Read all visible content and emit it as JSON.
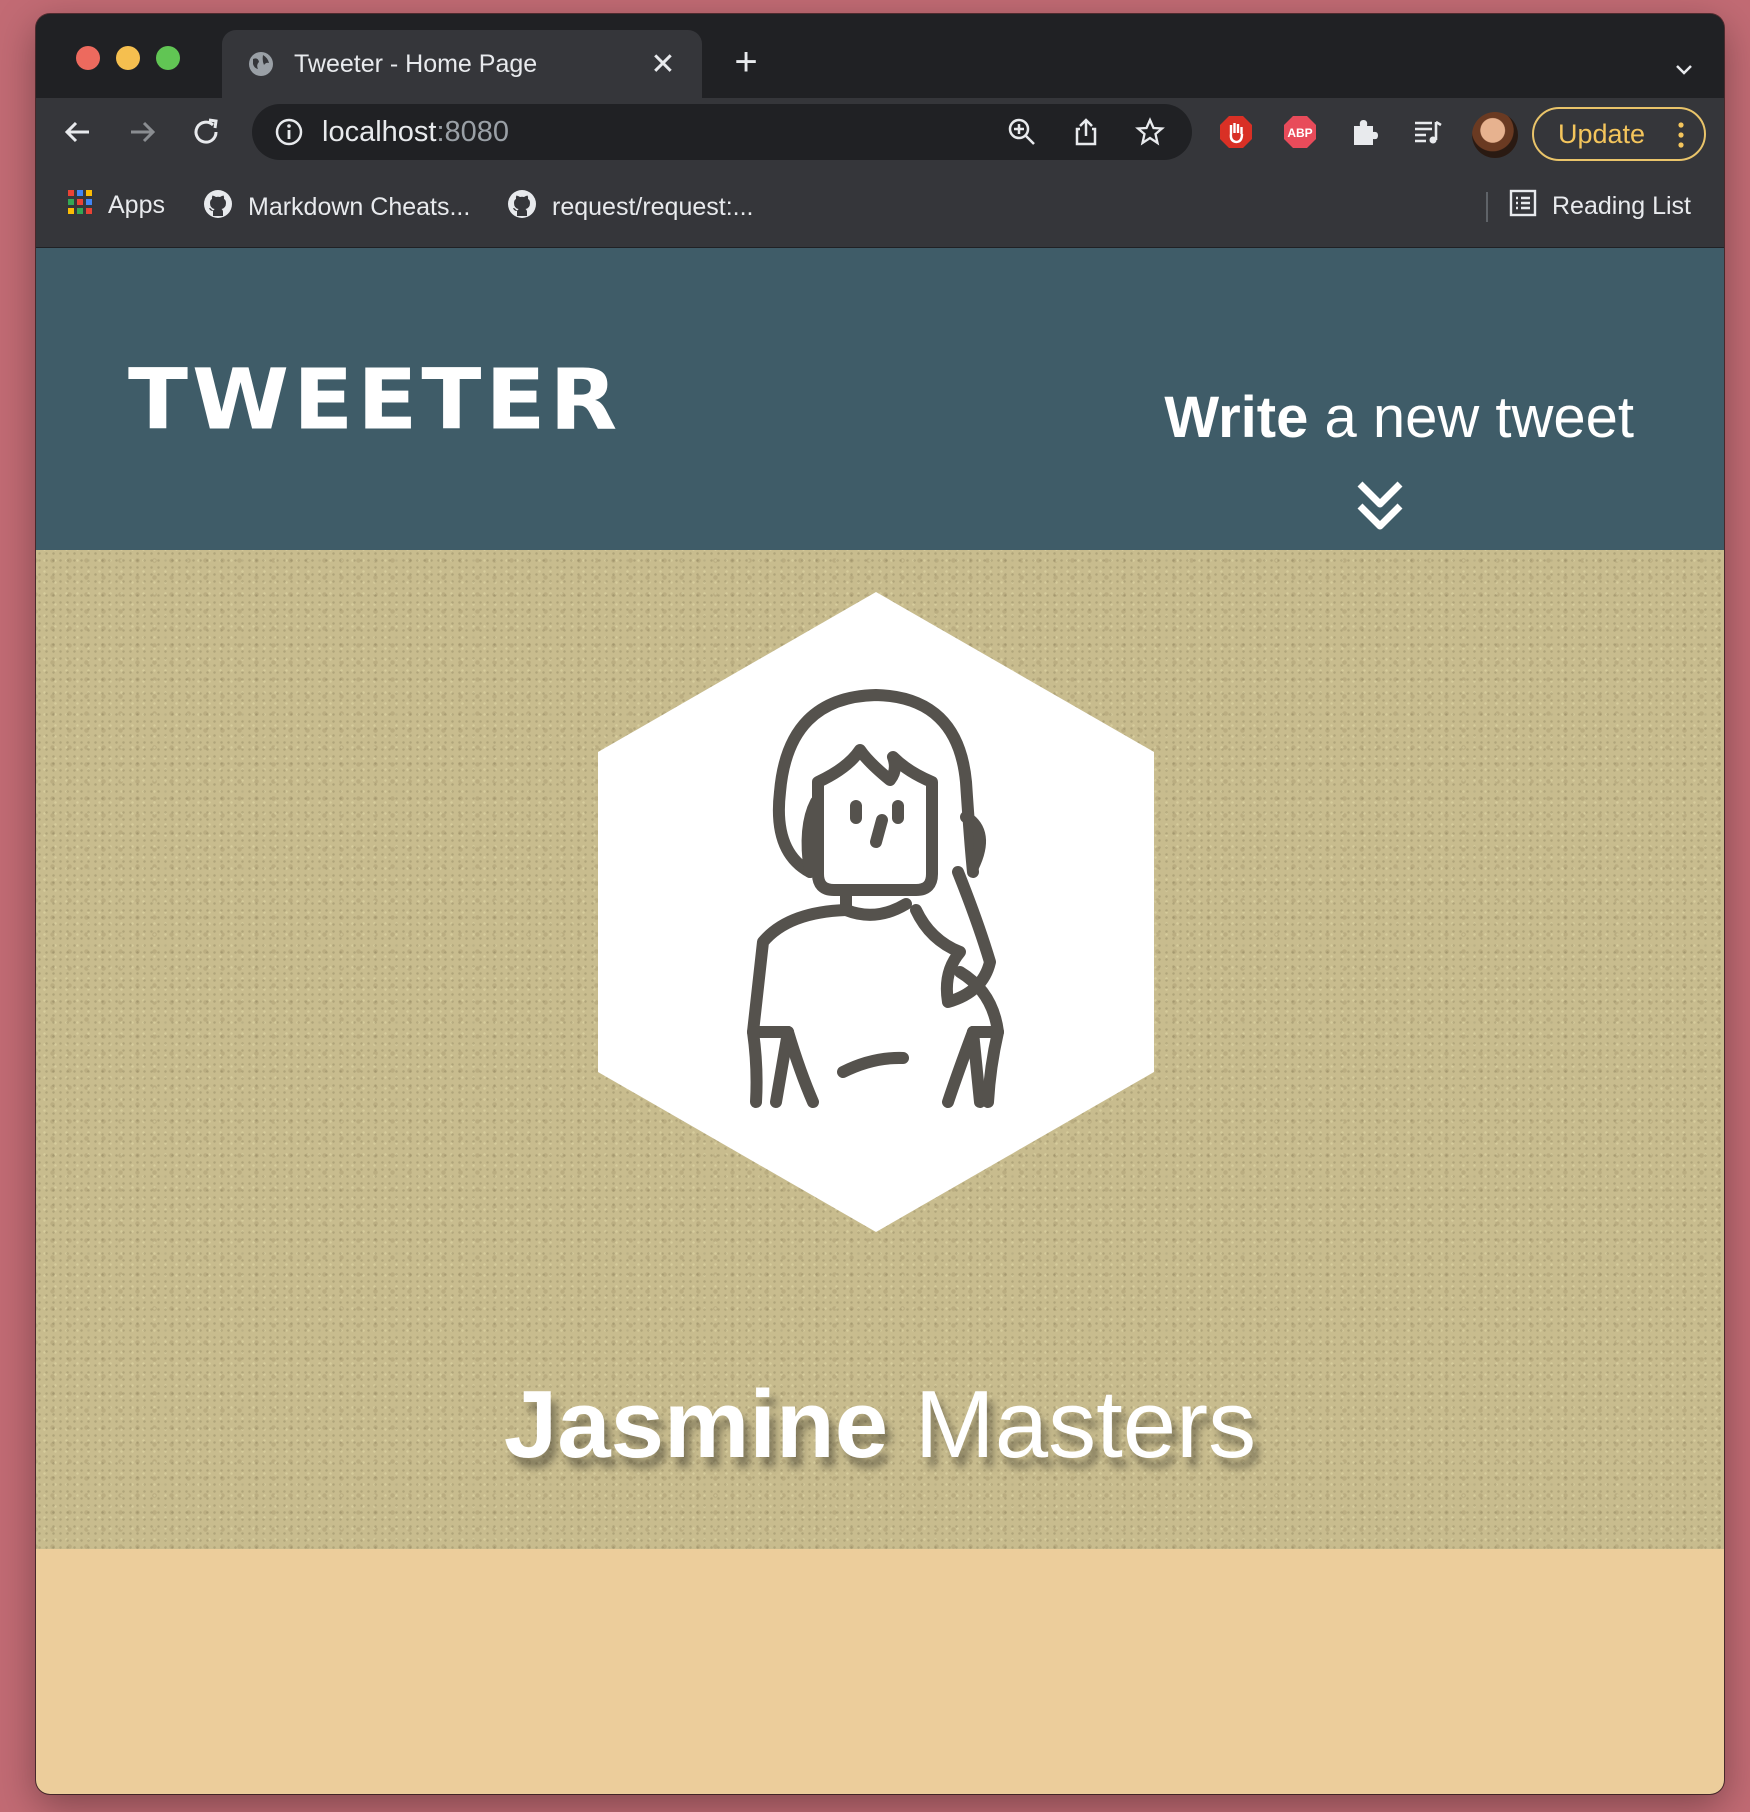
{
  "browser": {
    "tab": {
      "title": "Tweeter - Home Page",
      "close": "✕"
    },
    "new_tab": "+",
    "address": {
      "host": "localhost",
      "port": ":8080"
    },
    "update_label": "Update",
    "bookmarks": [
      {
        "label": "Apps",
        "icon": "apps-grid-icon"
      },
      {
        "label": "Markdown Cheats...",
        "icon": "github-icon"
      },
      {
        "label": "request/request:...",
        "icon": "github-icon"
      }
    ],
    "reading_list": "Reading List",
    "accent_colors": {
      "update": "#f4c55c",
      "tabstrip": "#202124",
      "toolbar": "#35363a"
    }
  },
  "page": {
    "logo": "TWEETER",
    "compose": {
      "strong": "Write",
      "rest": " a new tweet",
      "icon": "double-chevron-down-icon"
    },
    "profile": {
      "first_name": "Jasmine",
      "last_name": " Masters",
      "avatar_icon": "female-user-avatar-icon"
    },
    "colors": {
      "nav": "#3f5c68",
      "hero": "#c8bc8e",
      "below": "#eccd9b"
    }
  }
}
